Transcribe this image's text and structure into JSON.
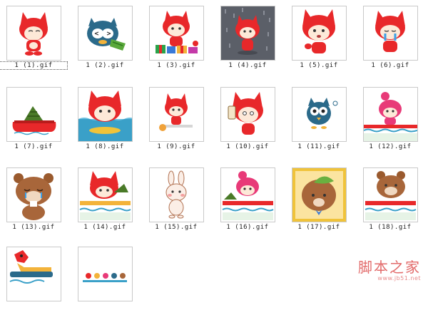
{
  "files": [
    {
      "label": "1 (1).gif",
      "icon": "red-fox-bowing-icon",
      "selected": true
    },
    {
      "label": "1 (2).gif",
      "icon": "blue-owl-eating-icon"
    },
    {
      "label": "1 (3).gif",
      "icon": "red-fox-gifts-icon"
    },
    {
      "label": "1 (4).gif",
      "icon": "red-fox-rain-icon"
    },
    {
      "label": "1 (5).gif",
      "icon": "red-fox-waving-icon"
    },
    {
      "label": "1 (6).gif",
      "icon": "red-fox-crying-icon"
    },
    {
      "label": "1 (7).gif",
      "icon": "zongzi-boat-icon"
    },
    {
      "label": "1 (8).gif",
      "icon": "red-fox-pool-icon"
    },
    {
      "label": "1 (9).gif",
      "icon": "red-fox-eating-icon"
    },
    {
      "label": "1 (10).gif",
      "icon": "red-fox-headache-icon"
    },
    {
      "label": "1 (11).gif",
      "icon": "blue-owl-standing-icon"
    },
    {
      "label": "1 (12).gif",
      "icon": "pink-fox-boat-icon"
    },
    {
      "label": "1 (13).gif",
      "icon": "brown-bear-crying-icon"
    },
    {
      "label": "1 (14).gif",
      "icon": "red-fox-boat-icon"
    },
    {
      "label": "1 (15).gif",
      "icon": "white-rabbit-icon"
    },
    {
      "label": "1 (16).gif",
      "icon": "pink-fox-rowing-icon"
    },
    {
      "label": "1 (17).gif",
      "icon": "bear-leaf-hat-icon"
    },
    {
      "label": "1 (18).gif",
      "icon": "brown-bear-boat-icon"
    },
    {
      "label": "",
      "icon": "dragon-boat-icon"
    },
    {
      "label": "",
      "icon": "tiny-characters-icon"
    }
  ],
  "watermark": {
    "text": "脚本之家",
    "url": "www.jb51.net"
  },
  "colors": {
    "fox_red": "#e8282a",
    "owl_blue": "#2b6a8a",
    "bear_brown": "#9a5a2e",
    "water": "#3aa0c8"
  }
}
